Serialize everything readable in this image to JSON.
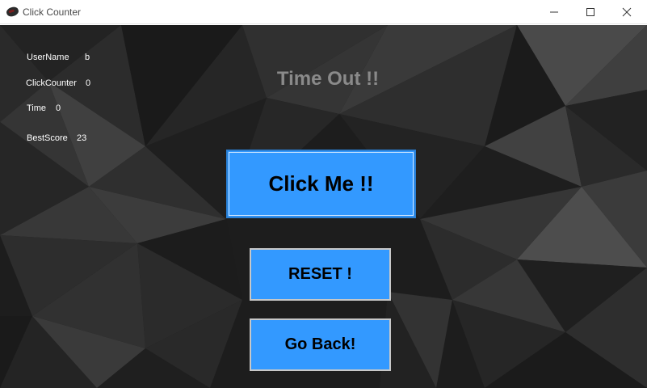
{
  "window": {
    "title": "Click Counter",
    "app_icon": "mouse-icon",
    "controls": [
      "minimize-icon",
      "maximize-icon",
      "close-icon"
    ]
  },
  "stats": {
    "username_label": "UserName",
    "username_value": "b",
    "clickcounter_label": "ClickCounter",
    "clickcounter_value": "0",
    "time_label": "Time",
    "time_value": "0",
    "bestscore_label": "BestScore",
    "bestscore_value": "23"
  },
  "status_message": "Time Out !!",
  "buttons": {
    "click_me": "Click Me !!",
    "reset": "RESET !",
    "go_back": "Go Back!"
  },
  "colors": {
    "button_fill": "#3399ff",
    "status_text": "#8a8a8a",
    "background": "#1c1c1c"
  }
}
